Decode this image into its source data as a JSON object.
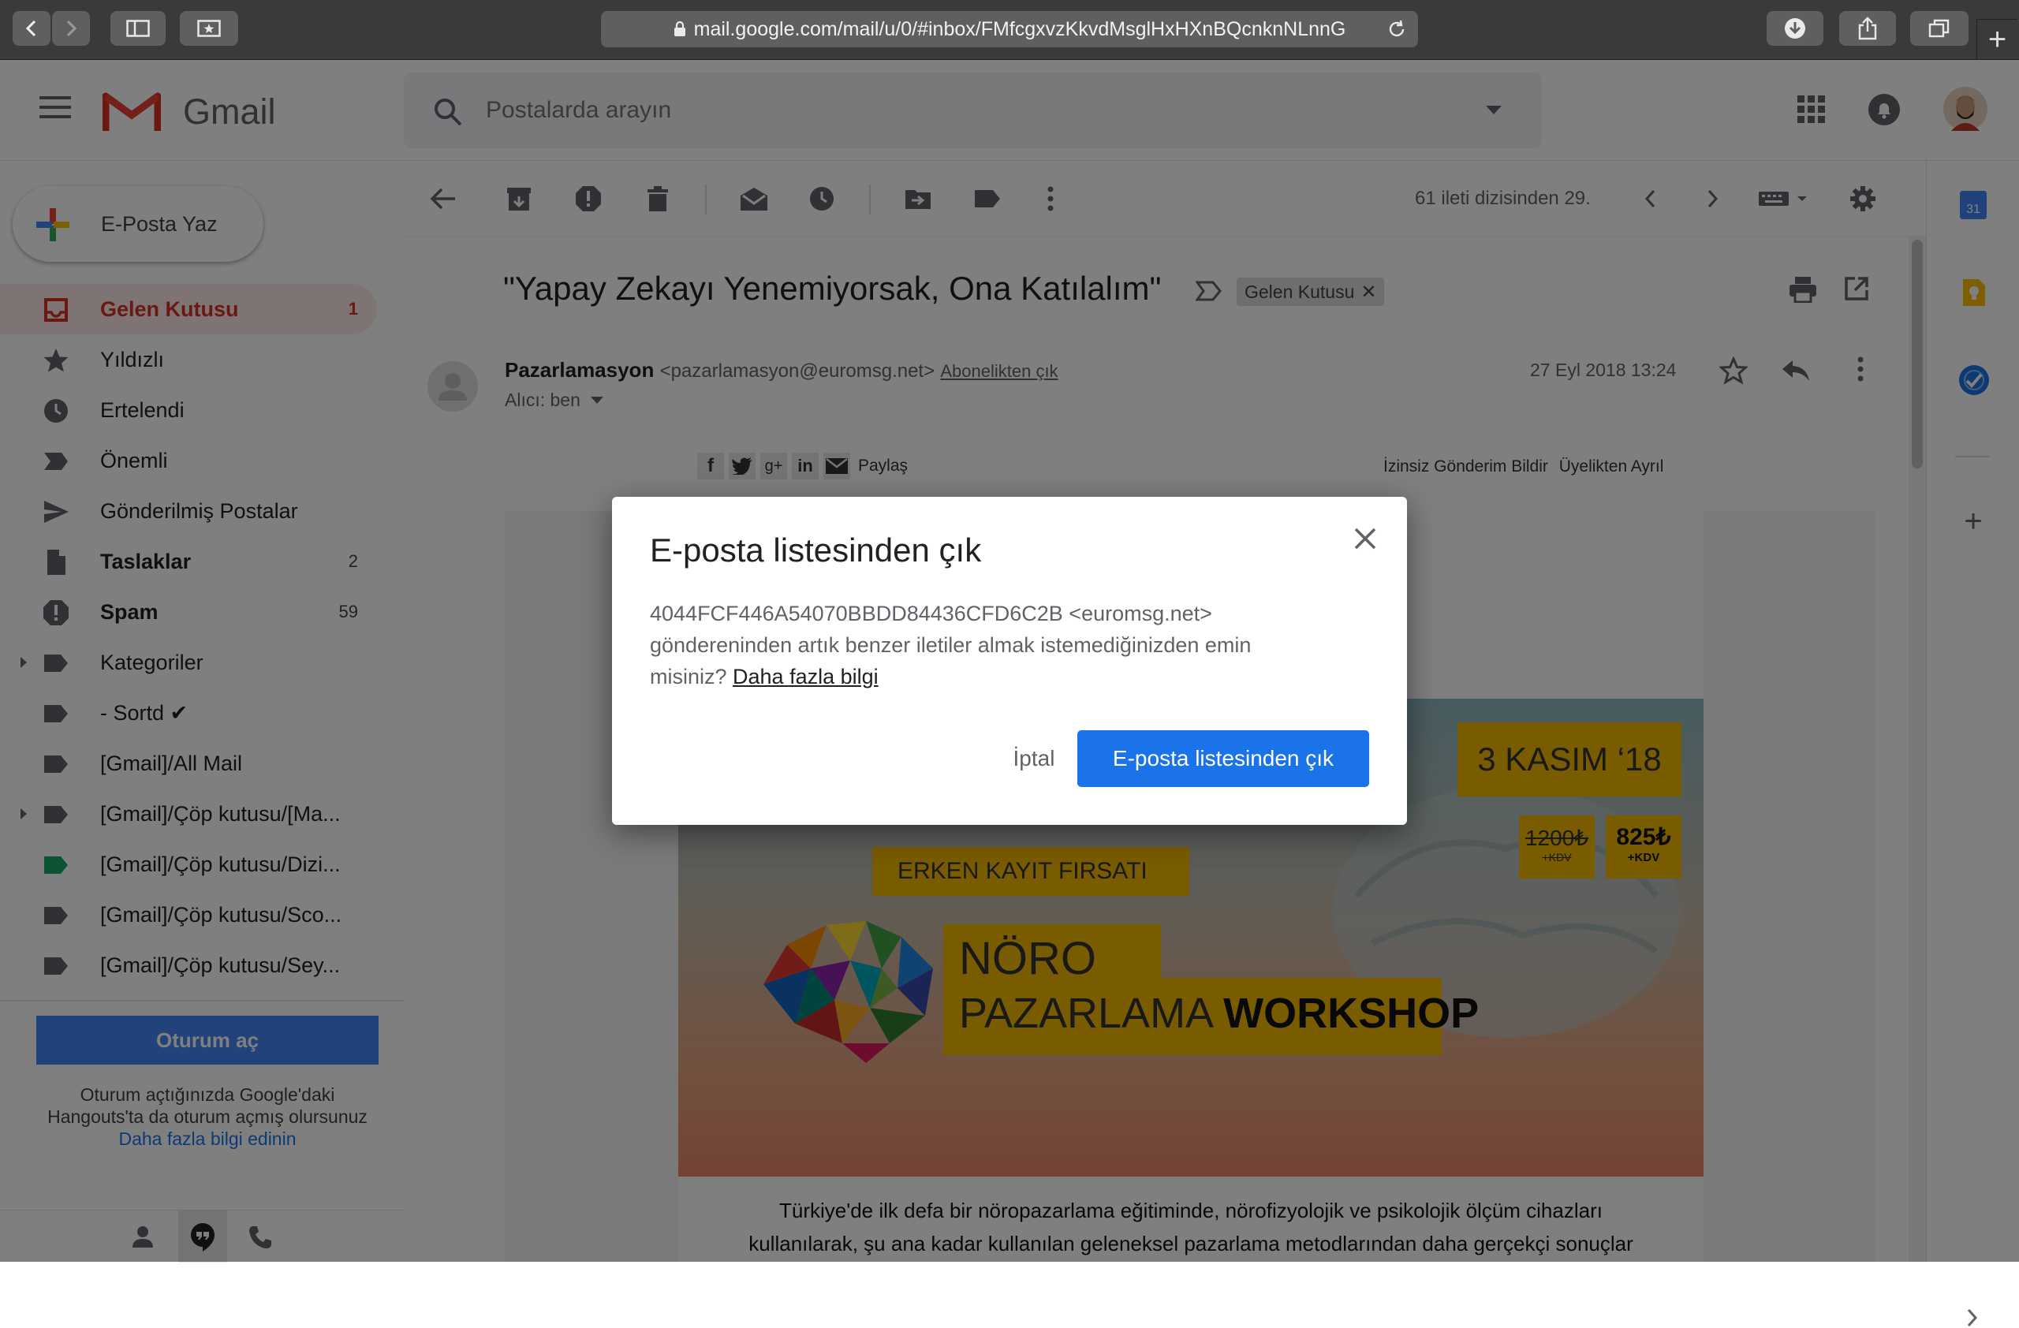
{
  "browser": {
    "url": "mail.google.com/mail/u/0/#inbox/FMfcgxvzKkvdMsglHxHXnBQcnknNLnnG",
    "new_tab_glyph": "+"
  },
  "app": {
    "logo_text": "Gmail",
    "search_placeholder": "Postalarda arayın"
  },
  "compose": {
    "label": "E-Posta Yaz"
  },
  "sidebar": {
    "items": [
      {
        "label": "Gelen Kutusu",
        "count": "1",
        "icon": "inbox-icon"
      },
      {
        "label": "Yıldızlı",
        "count": "",
        "icon": "star-icon"
      },
      {
        "label": "Ertelendi",
        "count": "",
        "icon": "clock-icon"
      },
      {
        "label": "Önemli",
        "count": "",
        "icon": "important-icon"
      },
      {
        "label": "Gönderilmiş Postalar",
        "count": "",
        "icon": "send-icon"
      },
      {
        "label": "Taslaklar",
        "count": "2",
        "icon": "draft-icon"
      },
      {
        "label": "Spam",
        "count": "59",
        "icon": "spam-icon"
      },
      {
        "label": "Kategoriler",
        "count": "",
        "icon": "label-icon"
      },
      {
        "label": "- Sortd ✔",
        "count": "",
        "icon": "label-icon"
      },
      {
        "label": "[Gmail]/All Mail",
        "count": "",
        "icon": "label-icon"
      },
      {
        "label": "[Gmail]/Çöp kutusu/[Ma...",
        "count": "",
        "icon": "label-icon"
      },
      {
        "label": "[Gmail]/Çöp kutusu/Dizi...",
        "count": "",
        "icon": "label-icon"
      },
      {
        "label": "[Gmail]/Çöp kutusu/Sco...",
        "count": "",
        "icon": "label-icon"
      },
      {
        "label": "[Gmail]/Çöp kutusu/Sey...",
        "count": "",
        "icon": "label-icon"
      }
    ],
    "signin_button": "Oturum aç",
    "hangouts_text_1": "Oturum açtığınızda Google'daki",
    "hangouts_text_2": "Hangouts'ta da oturum açmış olursunuz",
    "hangouts_link": "Daha fazla bilgi edinin"
  },
  "toolbar": {
    "pager_text": "61 ileti dizisinden 29."
  },
  "email": {
    "subject": "\"Yapay Zekayı Yenemiyorsak, Ona Katılalım\"",
    "label_chip": "Gelen Kutusu",
    "sender_name": "Pazarlamasyon",
    "sender_email": "<pazarlamasyon@euromsg.net>",
    "unsubscribe_link": "Abonelikten çık",
    "to_line": "Alıcı: ben",
    "date": "27 Eyl 2018 13:24",
    "share_label": "Paylaş",
    "report_link": "İzinsiz Gönderim Bildir",
    "leave_link": "Üyelikten Ayrıl",
    "banner": {
      "date": "3 KASIM ‘18",
      "old_price": "1200₺",
      "old_price_note": "+KDV",
      "new_price": "825₺",
      "new_price_note": "+KDV",
      "early_bird": "ERKEN KAYIT FIRSATI",
      "title_line1": "NÖRO",
      "title_line2a": "PAZARLAMA ",
      "title_line2b": "WORKSHOP"
    },
    "body_line1": "Türkiye'de ilk defa bir nöropazarlama eğitiminde, nörofizyolojik ve psikolojik ölçüm cihazları",
    "body_line2": "kullanılarak, şu ana kadar kullanılan geleneksel pazarlama metodlarından daha gerçekçi sonuçlar"
  },
  "dialog": {
    "title": "E-posta listesinden çık",
    "body_line1": "4044FCF446A54070BBDD84436CFD6C2B <euromsg.net>",
    "body_line2": "göndereninden artık benzer iletiler almak istemediğinizden emin",
    "body_line3": "misiniz? ",
    "learn_more": "Daha fazla bilgi",
    "cancel": "İptal",
    "confirm": "E-posta listesinden çık"
  },
  "rightbar": {
    "calendar_day": "31",
    "add_glyph": "+"
  },
  "colors": {
    "accent_red": "#d93025",
    "primary_blue": "#1a73e8",
    "banner_yellow": "#f2b600"
  }
}
